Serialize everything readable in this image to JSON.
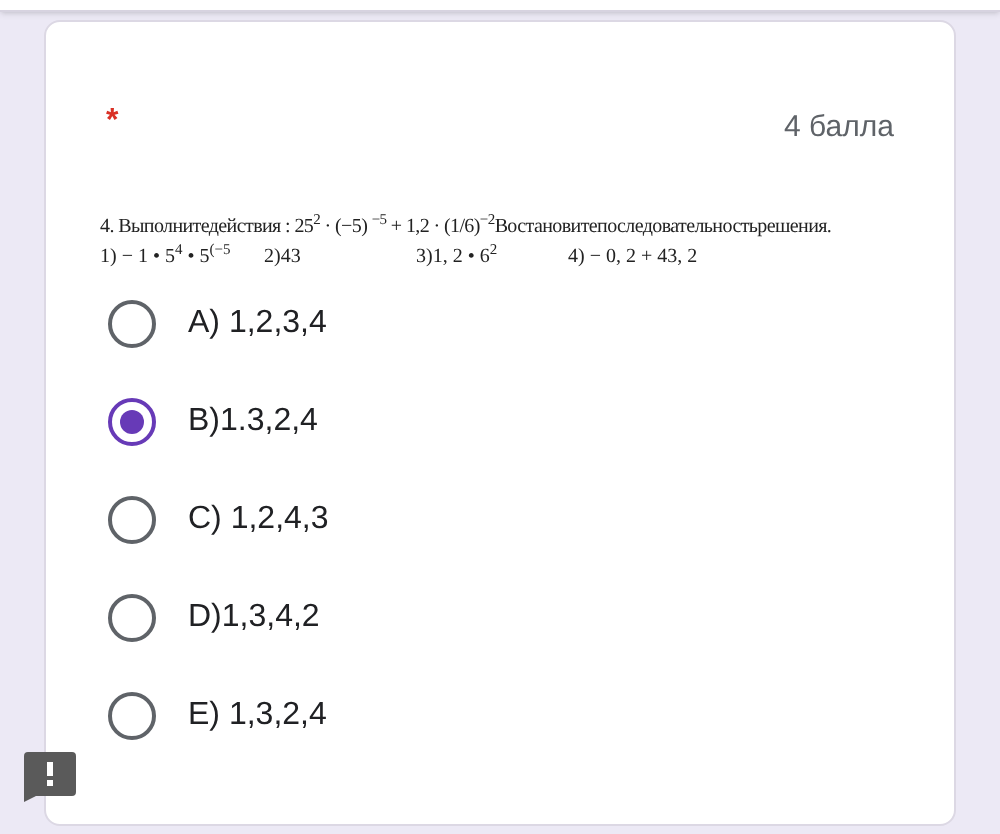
{
  "question": {
    "required_mark": "*",
    "points": "4 балла",
    "text_lines": [
      "4. Выполнитедействия :   25$^{2}$ · (−5) $^{−5}$ + 1,2 · (1/6)$^{−2}$Востановитепоследовательностьрешения.",
      "1) − 1 • 5$^{4}$ • 5$^{(−5}$"
    ],
    "text_items": [
      "2)43",
      "3)1, 2 • 6$^{2}$",
      "4) − 0, 2 + 43, 2"
    ],
    "options": [
      {
        "label": "A) 1,2,3,4",
        "selected": false
      },
      {
        "label": "B)1.3,2,4",
        "selected": true
      },
      {
        "label": "C) 1,2,4,3",
        "selected": false
      },
      {
        "label": "D)1,3,4,2",
        "selected": false
      },
      {
        "label": "E) 1,3,2,4",
        "selected": false
      }
    ]
  }
}
